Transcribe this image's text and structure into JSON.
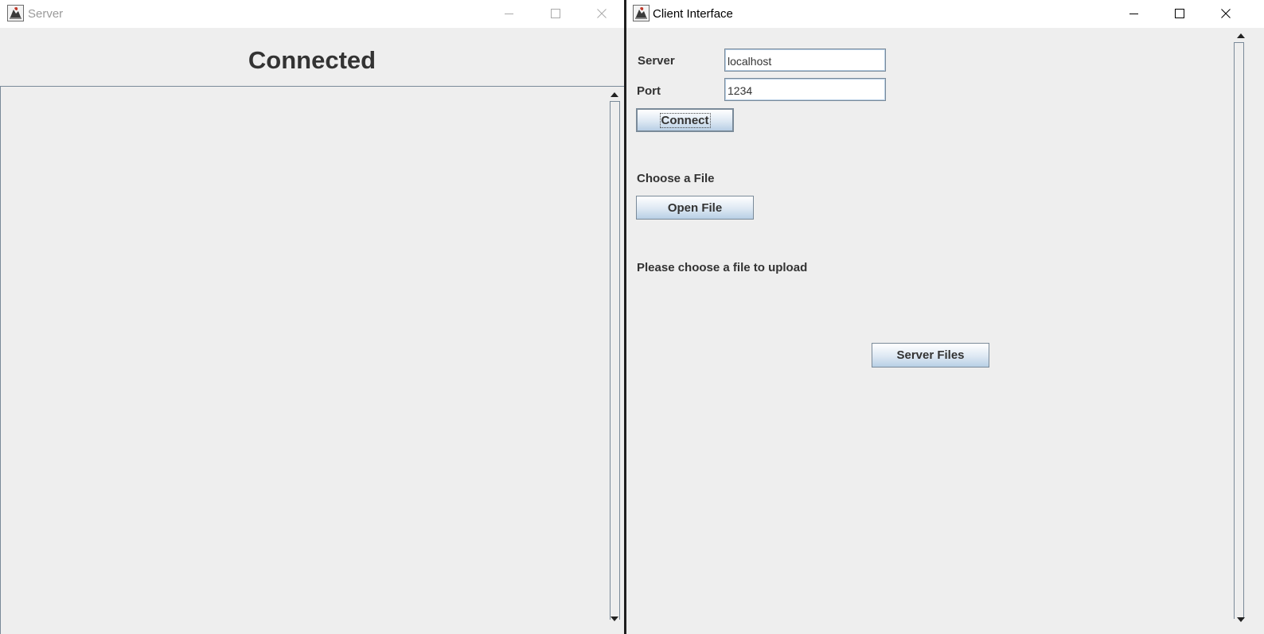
{
  "server_window": {
    "title": "Server",
    "status_heading": "Connected"
  },
  "client_window": {
    "title": "Client Interface",
    "server_label": "Server",
    "server_value": "localhost",
    "port_label": "Port",
    "port_value": "1234",
    "connect_label": "Connect",
    "choose_file_label": "Choose a File",
    "open_file_label": "Open File",
    "status_message": "Please choose a file to upload",
    "server_files_label": "Server Files"
  },
  "icons": {
    "app_icon": "java-app-icon",
    "minimize": "minimize-icon",
    "maximize": "maximize-icon",
    "close": "close-icon",
    "scroll_up": "scroll-up-arrow-icon",
    "scroll_down": "scroll-down-arrow-icon"
  },
  "colors": {
    "background": "#eeeeee",
    "button_gradient_bottom": "#b8cfe5",
    "border": "#7a8a99",
    "text": "#333333"
  }
}
